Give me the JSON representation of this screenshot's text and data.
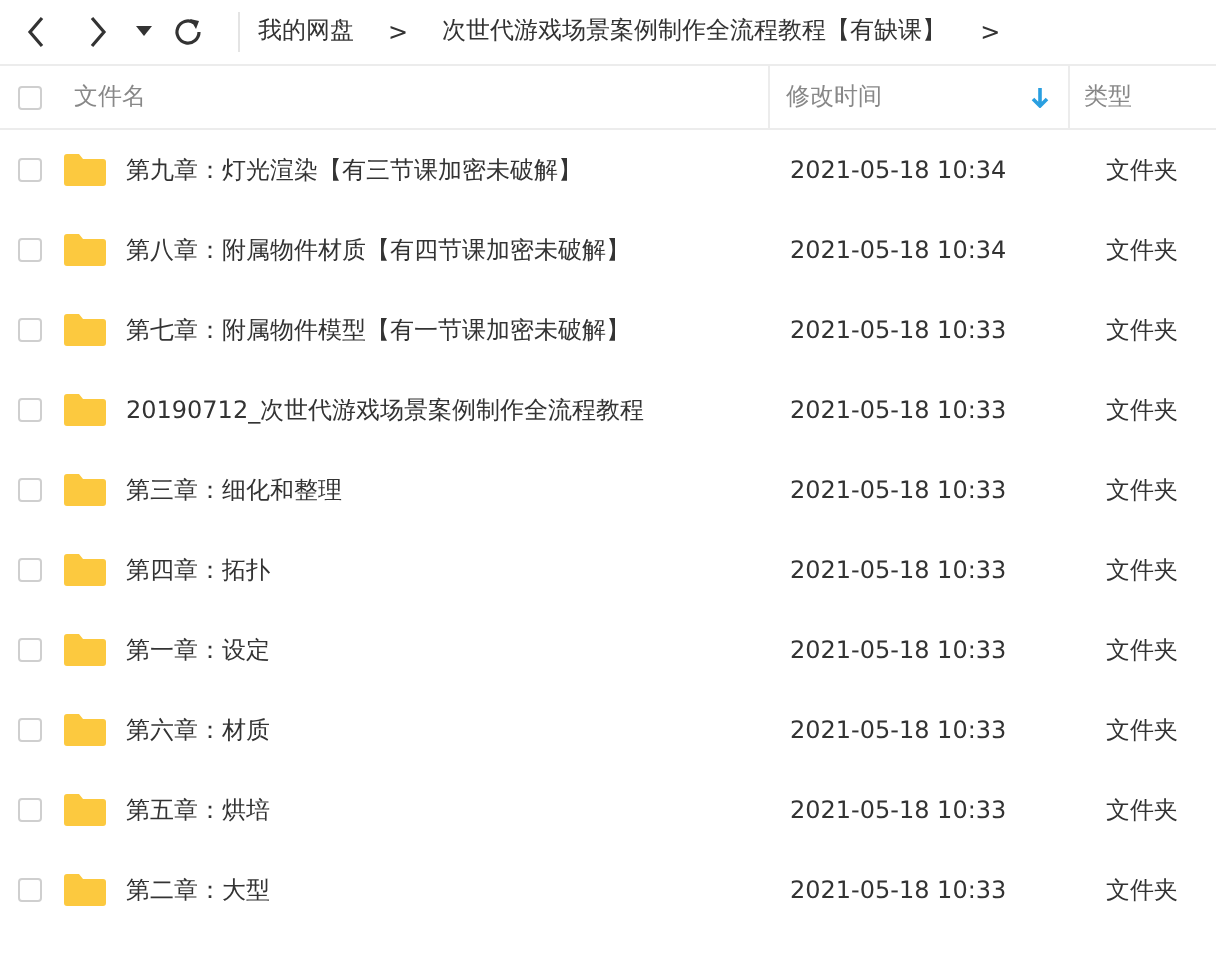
{
  "toolbar": {
    "breadcrumb": [
      {
        "kind": "link",
        "text": "我的网盘"
      },
      {
        "kind": "sep",
        "text": ">"
      },
      {
        "kind": "link",
        "text": "次世代游戏场景案例制作全流程教程【有缺课】"
      },
      {
        "kind": "sep",
        "text": ">"
      }
    ]
  },
  "table": {
    "select_all": {
      "checked": false
    },
    "columns": [
      {
        "label": "文件名",
        "sorted": false
      },
      {
        "label": "修改时间",
        "sorted": true
      },
      {
        "label": "类型",
        "sorted": false
      }
    ],
    "rows": [
      {
        "checked": false,
        "name": "第九章：灯光渲染【有三节课加密未破解】",
        "modified": "2021-05-18 10:34",
        "type": "文件夹"
      },
      {
        "checked": false,
        "name": "第八章：附属物件材质【有四节课加密未破解】",
        "modified": "2021-05-18 10:34",
        "type": "文件夹"
      },
      {
        "checked": false,
        "name": "第七章：附属物件模型【有一节课加密未破解】",
        "modified": "2021-05-18 10:33",
        "type": "文件夹"
      },
      {
        "checked": false,
        "name": "20190712_次世代游戏场景案例制作全流程教程",
        "modified": "2021-05-18 10:33",
        "type": "文件夹"
      },
      {
        "checked": false,
        "name": "第三章：细化和整理",
        "modified": "2021-05-18 10:33",
        "type": "文件夹"
      },
      {
        "checked": false,
        "name": "第四章：拓扑",
        "modified": "2021-05-18 10:33",
        "type": "文件夹"
      },
      {
        "checked": false,
        "name": "第一章：设定",
        "modified": "2021-05-18 10:33",
        "type": "文件夹"
      },
      {
        "checked": false,
        "name": "第六章：材质",
        "modified": "2021-05-18 10:33",
        "type": "文件夹"
      },
      {
        "checked": false,
        "name": "第五章：烘培",
        "modified": "2021-05-18 10:33",
        "type": "文件夹"
      },
      {
        "checked": false,
        "name": "第二章：大型",
        "modified": "2021-05-18 10:33",
        "type": "文件夹"
      }
    ]
  }
}
